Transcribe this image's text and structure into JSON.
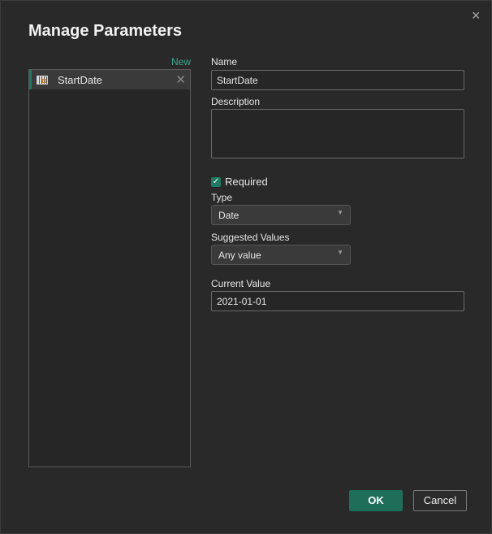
{
  "dialog": {
    "title": "Manage Parameters",
    "close_icon": "×",
    "new_label": "New",
    "parameters": [
      {
        "label": "StartDate",
        "icon": "table-icon"
      }
    ],
    "name_label": "Name",
    "name_value": "StartDate",
    "description_label": "Description",
    "description_value": "",
    "required_label": "Required",
    "required_checked": true,
    "type_label": "Type",
    "type_value": "Date",
    "suggested_label": "Suggested Values",
    "suggested_value": "Any value",
    "current_label": "Current Value",
    "current_value": "2021-01-01",
    "ok_label": "OK",
    "cancel_label": "Cancel"
  },
  "colors": {
    "accent": "#1e7a62",
    "new_link": "#3ba88a"
  }
}
